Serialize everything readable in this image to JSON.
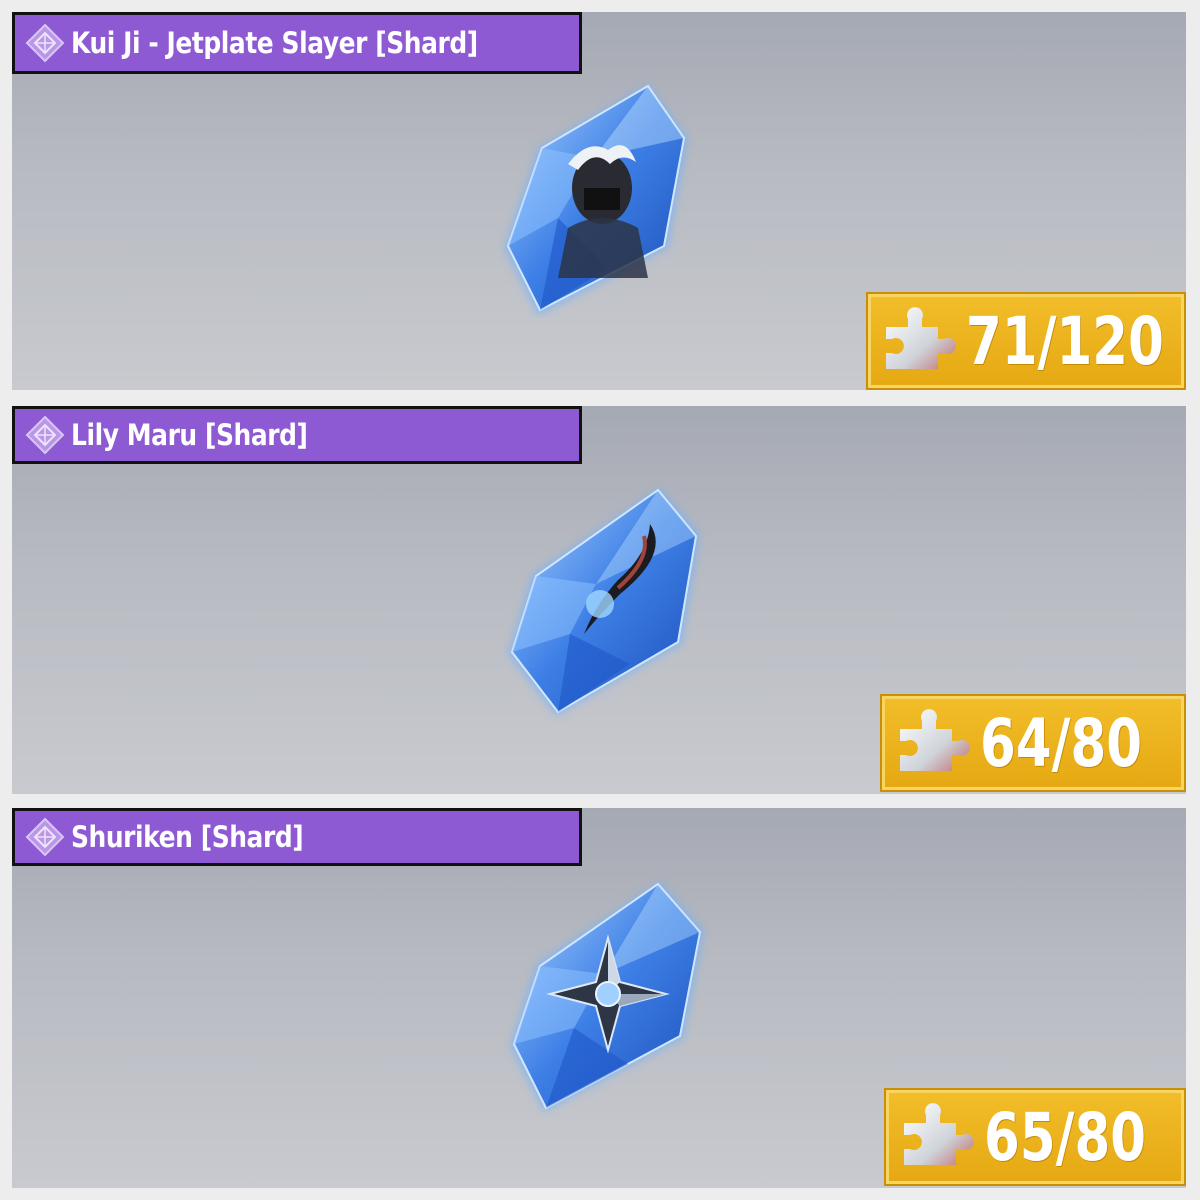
{
  "items": [
    {
      "title": "Kui Ji - Jetplate Slayer [Shard]",
      "count": "71/120",
      "gem_art": "masked-ninja-portrait"
    },
    {
      "title": "Lily Maru [Shard]",
      "count": "64/80",
      "gem_art": "dark-blade"
    },
    {
      "title": "Shuriken [Shard]",
      "count": "65/80",
      "gem_art": "shuriken"
    }
  ],
  "colors": {
    "title_bar": "#8e5ad4",
    "counter_bg": "#f2be2a",
    "gem_blue": "#3d7fe6"
  },
  "icons": {
    "title": "diamond-emblem-icon",
    "counter": "puzzle-piece-icon"
  }
}
